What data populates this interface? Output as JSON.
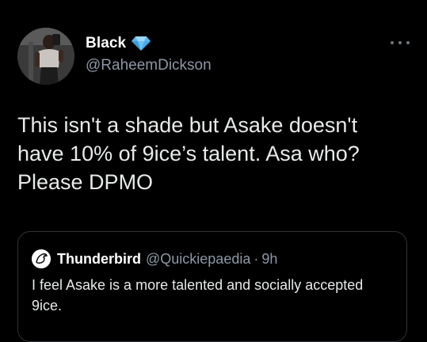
{
  "tweet": {
    "author": {
      "display_name": "Black",
      "handle": "@RaheemDickson",
      "verified_icon": "blue-diamond-icon",
      "avatar_icon": "profile-photo"
    },
    "more_icon": "more-dots-icon",
    "text": "This isn't a shade but Asake doesn't\nhave 10% of 9ice’s talent. Asa who?\nPlease DPMO",
    "quote": {
      "avatar_icon": "bird-logo-avatar",
      "display_name": "Thunderbird",
      "handle": "@Quickiepaedia",
      "separator": "·",
      "time": "9h",
      "text": "I feel Asake is a more talented and socially accepted 9ice."
    }
  },
  "colors": {
    "background": "#000000",
    "primary_text": "#e7e9ea",
    "secondary_text": "#8b98a5",
    "border": "#2f3336",
    "verified": "#5ab8f0"
  }
}
